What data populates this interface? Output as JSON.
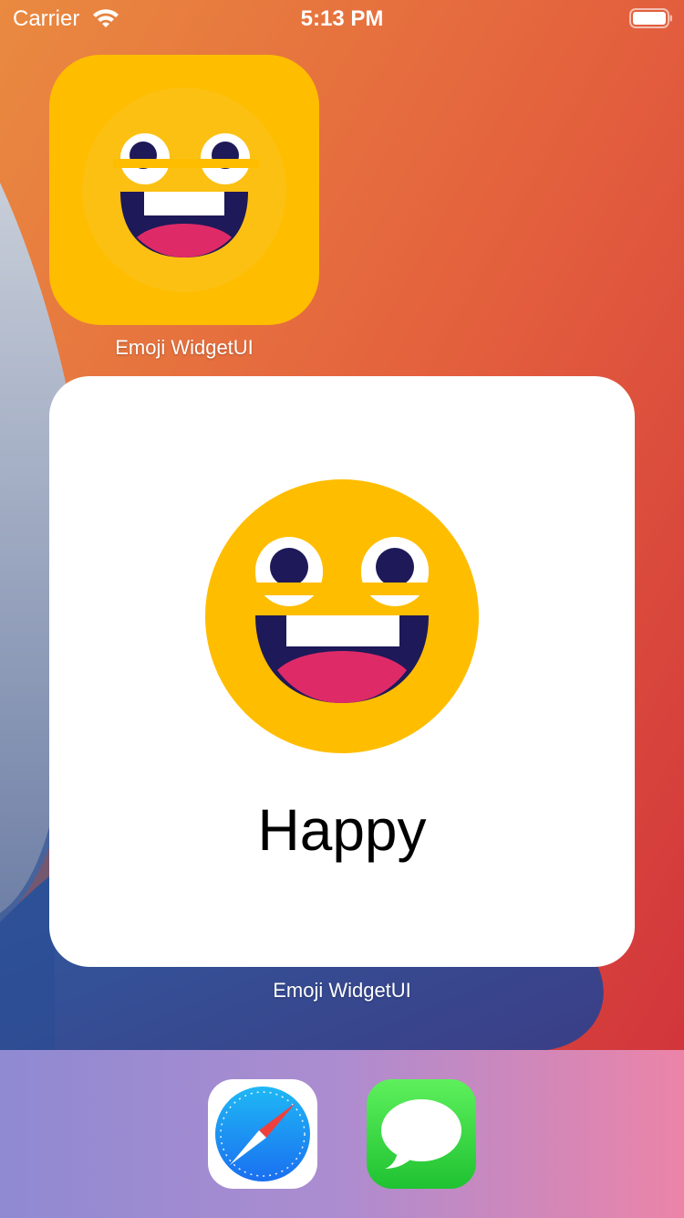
{
  "status_bar": {
    "carrier": "Carrier",
    "time": "5:13 PM"
  },
  "home_screen": {
    "app_icon": {
      "label": "Emoji WidgetUI",
      "icon": "grinning-face-icon",
      "background_color": "#ffbd00"
    },
    "widget": {
      "mood": "Happy",
      "emoji": "grinning-face-icon",
      "label": "Emoji WidgetUI",
      "background_color": "#ffffff"
    }
  },
  "dock": {
    "apps": [
      {
        "name": "Safari",
        "icon": "safari-compass-icon"
      },
      {
        "name": "Messages",
        "icon": "messages-bubble-icon"
      }
    ]
  },
  "colors": {
    "emoji_yellow": "#ffbd00",
    "emoji_dark": "#1e1958",
    "emoji_tongue": "#df2a68",
    "wallpaper_orange": "#e8783e",
    "wallpaper_red": "#d9363b"
  }
}
